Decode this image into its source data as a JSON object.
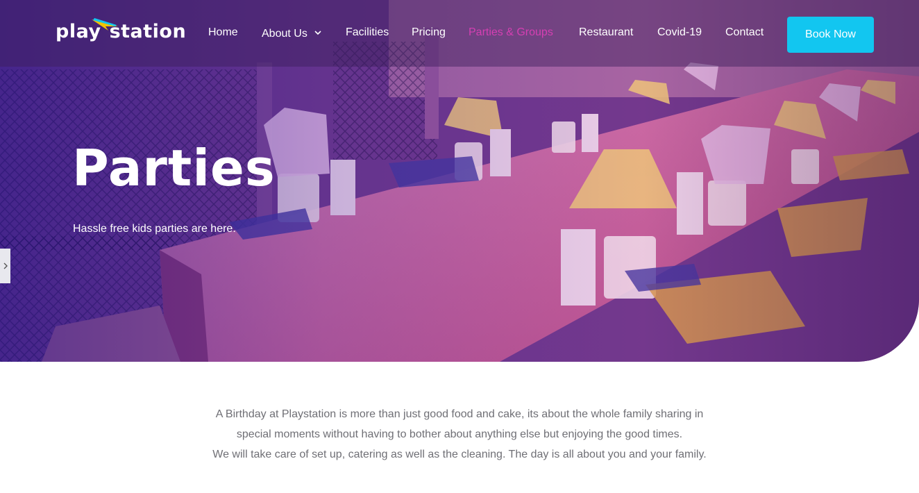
{
  "brand": {
    "logo_word1": "play",
    "logo_word2": "station",
    "accent": "#12c6f0",
    "active_nav": "#d63fb3"
  },
  "nav": {
    "items": [
      {
        "label": "Home"
      },
      {
        "label": "About Us",
        "has_dropdown": true
      },
      {
        "label": "Facilities"
      },
      {
        "label": "Pricing"
      },
      {
        "label": "Parties & Groups",
        "active": true
      },
      {
        "label": "Restaurant"
      },
      {
        "label": "Covid-19"
      },
      {
        "label": "Contact"
      }
    ],
    "cta_label": "Book Now"
  },
  "hero": {
    "title": "Parties",
    "subtitle": "Hassle free kids parties are here."
  },
  "intro": {
    "line1": "A Birthday at Playstation is more than just good food and cake, its about the whole family sharing in",
    "line2": "special moments without having to bother about anything else but enjoying the good times.",
    "line3": "We will take care of set up, catering as well as the cleaning. The day is all about you and your family."
  },
  "icons": {
    "dropdown": "chevron-down-icon",
    "side_tab": "chevron-right-icon"
  }
}
